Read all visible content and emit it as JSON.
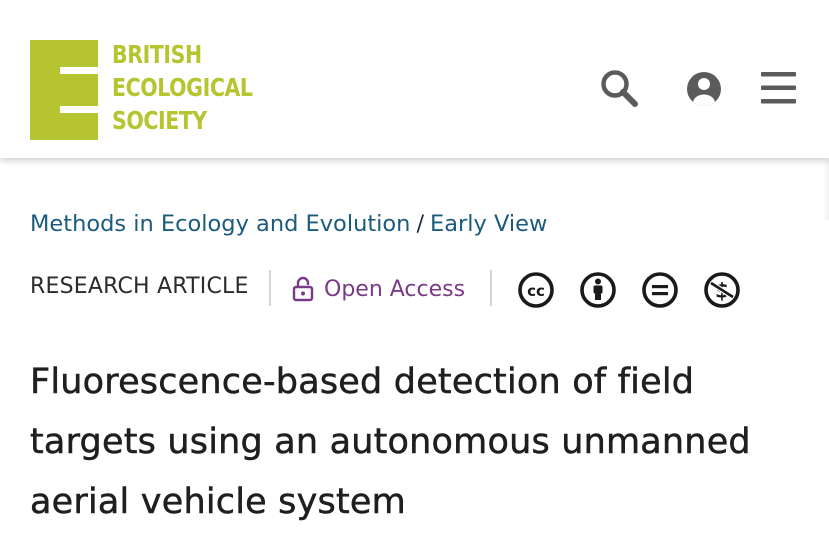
{
  "header": {
    "logo_lines": [
      "BRITISH",
      "ECOLOGICAL",
      "SOCIETY"
    ],
    "icons": [
      "search-icon",
      "user-account-icon",
      "menu-icon"
    ]
  },
  "breadcrumb": {
    "journal": "Methods in Ecology and Evolution",
    "separator": "/",
    "issue": "Early View"
  },
  "article_meta": {
    "type": "RESEARCH ARTICLE",
    "access": "Open Access",
    "license_icons": [
      "cc-icon",
      "cc-by-icon",
      "cc-nd-icon",
      "cc-nc-icon"
    ]
  },
  "article": {
    "title": "Fluorescence-based detection of field targets using an autonomous unmanned aerial vehicle system"
  },
  "colors": {
    "brand": "#b5c42f",
    "link": "#1b5b7f",
    "open_access": "#7a3a87",
    "text": "#1f1f1f"
  }
}
